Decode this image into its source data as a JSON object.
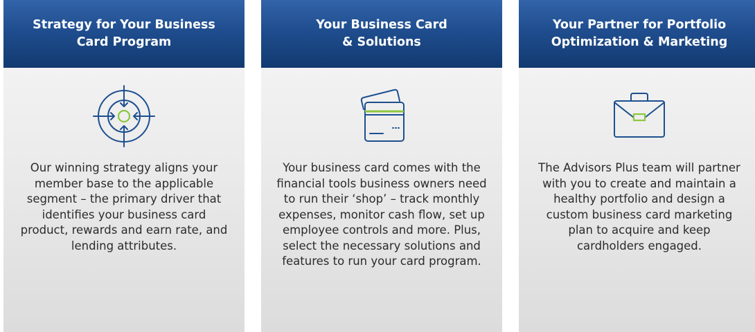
{
  "cards": [
    {
      "title": "Strategy for Your Business\nCard Program",
      "icon": "target-icon",
      "body": "Our winning strategy aligns your member base to the applicable segment – the primary driver that identifies your business card product, rewards and earn rate, and lending attributes."
    },
    {
      "title": "Your Business Card\n& Solutions",
      "icon": "credit-card-icon",
      "body": "Your business card comes with the financial tools business owners need to run their ‘shop’ – track monthly expenses, monitor cash flow, set up employee controls and more. Plus, select the necessary solutions and features to run your card program."
    },
    {
      "title": "Your Partner for Portfolio\nOptimization & Marketing",
      "icon": "briefcase-icon",
      "body": "The Advisors Plus team will partner with you to create and maintain a healthy portfolio and design a custom business card marketing plan to acquire and keep cardholders engaged."
    }
  ],
  "colors": {
    "header_blue": "#1f4d8e",
    "icon_blue": "#1c4f8f",
    "icon_green": "#8dc63f",
    "text": "#2b2b2b"
  }
}
